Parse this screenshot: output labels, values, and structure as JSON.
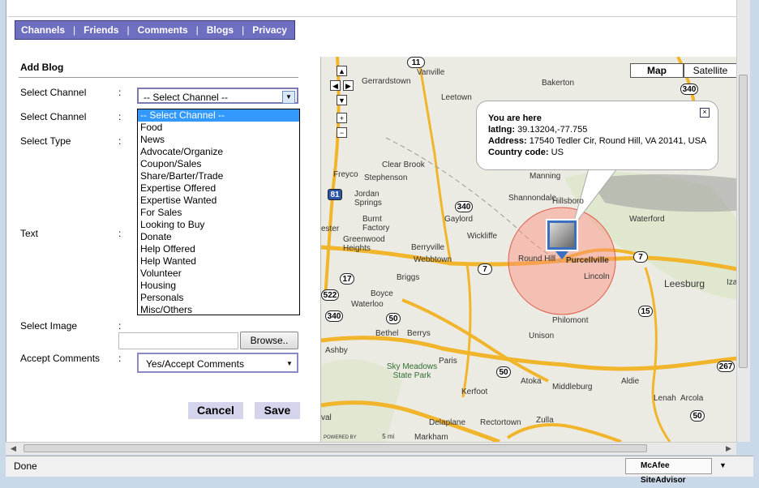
{
  "nav": {
    "items": [
      "Channels",
      "Friends",
      "Comments",
      "Blogs",
      "Privacy"
    ],
    "separator": "|"
  },
  "form": {
    "title": "Add Blog",
    "labels": {
      "select_channel_1": "Select Channel",
      "select_channel_2": "Select Channel",
      "select_type": "Select Type",
      "text": "Text",
      "select_image": "Select Image",
      "accept_comments": "Accept Comments"
    },
    "colon": ":",
    "channel_select_value": "-- Select Channel --",
    "channel_options": [
      "-- Select Channel --",
      "Food",
      "News",
      "Advocate/Organize",
      "Coupon/Sales",
      "Share/Barter/Trade",
      "Expertise Offered",
      "Expertise Wanted",
      "For Sales",
      "Looking to Buy",
      "Donate",
      "Help Offered",
      "Help Wanted",
      "Volunteer",
      "Housing",
      "Personals",
      "Misc/Others"
    ],
    "browse_label": "Browse..",
    "accept_comments_value": "Yes/Accept Comments",
    "cancel_label": "Cancel",
    "save_label": "Save"
  },
  "map": {
    "types": [
      "Map",
      "Satellite"
    ],
    "active_type": "Map",
    "info_window": {
      "heading": "You are here",
      "latlng_label": "latlng:",
      "latlng_value": "39.13204,-77.755",
      "address_label": "Address:",
      "address_value": "17540 Tedler Cir, Round Hill, VA 20141, USA",
      "country_label": "Country code:",
      "country_value": "US"
    },
    "places": [
      "Gerrardstown",
      "Vanville",
      "Bakerton",
      "Leetown",
      "Clear Brook",
      "Manning",
      "Freyco",
      "Stephenson",
      "Jordan Springs",
      "Shannondale",
      "Hillsboro",
      "Waterford",
      "Gaylord",
      "Wickliffe",
      "ester",
      "Burnt Factory",
      "Greenwood Heights",
      "Berryville",
      "Webbtown",
      "Round Hill",
      "Purcellville",
      "Lincoln",
      "Leesburg",
      "Briggs",
      "Boyce",
      "Waterloo",
      "Philomont",
      "Bethel",
      "Berrys",
      "Unison",
      "Ashby",
      "Paris",
      "Sky Meadows State Park",
      "Atoka",
      "Middleburg",
      "Aldie",
      "Lenah",
      "Arcola",
      "Kerfoot",
      "Zulla",
      "Delaplane",
      "Rectortown",
      "Markham",
      "val",
      "Iza"
    ],
    "routes": [
      "11",
      "340",
      "81",
      "340",
      "7",
      "17",
      "522",
      "340",
      "50",
      "7",
      "15",
      "50",
      "50",
      "267"
    ],
    "powered": "POWERED BY",
    "scale": "5 mi"
  },
  "status": {
    "text": "Done",
    "mcafee": "McAfee SiteAdvisor"
  },
  "icons": {
    "dropdown": "chevron-down-icon",
    "close": "close-icon",
    "marker": "photo-marker-icon"
  }
}
